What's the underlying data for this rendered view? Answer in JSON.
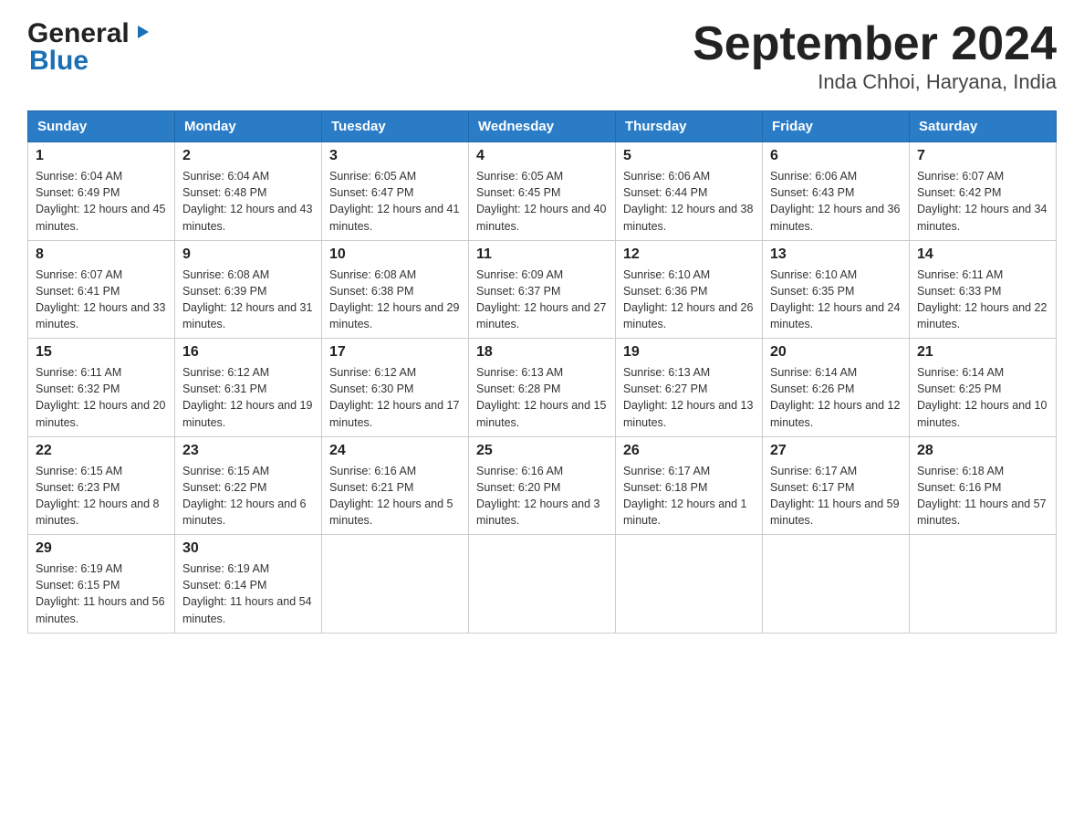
{
  "header": {
    "logo_general": "General",
    "logo_blue": "Blue",
    "title": "September 2024",
    "subtitle": "Inda Chhoi, Haryana, India"
  },
  "days_of_week": [
    "Sunday",
    "Monday",
    "Tuesday",
    "Wednesday",
    "Thursday",
    "Friday",
    "Saturday"
  ],
  "weeks": [
    [
      {
        "day": "1",
        "sunrise": "6:04 AM",
        "sunset": "6:49 PM",
        "daylight": "12 hours and 45 minutes."
      },
      {
        "day": "2",
        "sunrise": "6:04 AM",
        "sunset": "6:48 PM",
        "daylight": "12 hours and 43 minutes."
      },
      {
        "day": "3",
        "sunrise": "6:05 AM",
        "sunset": "6:47 PM",
        "daylight": "12 hours and 41 minutes."
      },
      {
        "day": "4",
        "sunrise": "6:05 AM",
        "sunset": "6:45 PM",
        "daylight": "12 hours and 40 minutes."
      },
      {
        "day": "5",
        "sunrise": "6:06 AM",
        "sunset": "6:44 PM",
        "daylight": "12 hours and 38 minutes."
      },
      {
        "day": "6",
        "sunrise": "6:06 AM",
        "sunset": "6:43 PM",
        "daylight": "12 hours and 36 minutes."
      },
      {
        "day": "7",
        "sunrise": "6:07 AM",
        "sunset": "6:42 PM",
        "daylight": "12 hours and 34 minutes."
      }
    ],
    [
      {
        "day": "8",
        "sunrise": "6:07 AM",
        "sunset": "6:41 PM",
        "daylight": "12 hours and 33 minutes."
      },
      {
        "day": "9",
        "sunrise": "6:08 AM",
        "sunset": "6:39 PM",
        "daylight": "12 hours and 31 minutes."
      },
      {
        "day": "10",
        "sunrise": "6:08 AM",
        "sunset": "6:38 PM",
        "daylight": "12 hours and 29 minutes."
      },
      {
        "day": "11",
        "sunrise": "6:09 AM",
        "sunset": "6:37 PM",
        "daylight": "12 hours and 27 minutes."
      },
      {
        "day": "12",
        "sunrise": "6:10 AM",
        "sunset": "6:36 PM",
        "daylight": "12 hours and 26 minutes."
      },
      {
        "day": "13",
        "sunrise": "6:10 AM",
        "sunset": "6:35 PM",
        "daylight": "12 hours and 24 minutes."
      },
      {
        "day": "14",
        "sunrise": "6:11 AM",
        "sunset": "6:33 PM",
        "daylight": "12 hours and 22 minutes."
      }
    ],
    [
      {
        "day": "15",
        "sunrise": "6:11 AM",
        "sunset": "6:32 PM",
        "daylight": "12 hours and 20 minutes."
      },
      {
        "day": "16",
        "sunrise": "6:12 AM",
        "sunset": "6:31 PM",
        "daylight": "12 hours and 19 minutes."
      },
      {
        "day": "17",
        "sunrise": "6:12 AM",
        "sunset": "6:30 PM",
        "daylight": "12 hours and 17 minutes."
      },
      {
        "day": "18",
        "sunrise": "6:13 AM",
        "sunset": "6:28 PM",
        "daylight": "12 hours and 15 minutes."
      },
      {
        "day": "19",
        "sunrise": "6:13 AM",
        "sunset": "6:27 PM",
        "daylight": "12 hours and 13 minutes."
      },
      {
        "day": "20",
        "sunrise": "6:14 AM",
        "sunset": "6:26 PM",
        "daylight": "12 hours and 12 minutes."
      },
      {
        "day": "21",
        "sunrise": "6:14 AM",
        "sunset": "6:25 PM",
        "daylight": "12 hours and 10 minutes."
      }
    ],
    [
      {
        "day": "22",
        "sunrise": "6:15 AM",
        "sunset": "6:23 PM",
        "daylight": "12 hours and 8 minutes."
      },
      {
        "day": "23",
        "sunrise": "6:15 AM",
        "sunset": "6:22 PM",
        "daylight": "12 hours and 6 minutes."
      },
      {
        "day": "24",
        "sunrise": "6:16 AM",
        "sunset": "6:21 PM",
        "daylight": "12 hours and 5 minutes."
      },
      {
        "day": "25",
        "sunrise": "6:16 AM",
        "sunset": "6:20 PM",
        "daylight": "12 hours and 3 minutes."
      },
      {
        "day": "26",
        "sunrise": "6:17 AM",
        "sunset": "6:18 PM",
        "daylight": "12 hours and 1 minute."
      },
      {
        "day": "27",
        "sunrise": "6:17 AM",
        "sunset": "6:17 PM",
        "daylight": "11 hours and 59 minutes."
      },
      {
        "day": "28",
        "sunrise": "6:18 AM",
        "sunset": "6:16 PM",
        "daylight": "11 hours and 57 minutes."
      }
    ],
    [
      {
        "day": "29",
        "sunrise": "6:19 AM",
        "sunset": "6:15 PM",
        "daylight": "11 hours and 56 minutes."
      },
      {
        "day": "30",
        "sunrise": "6:19 AM",
        "sunset": "6:14 PM",
        "daylight": "11 hours and 54 minutes."
      },
      null,
      null,
      null,
      null,
      null
    ]
  ]
}
